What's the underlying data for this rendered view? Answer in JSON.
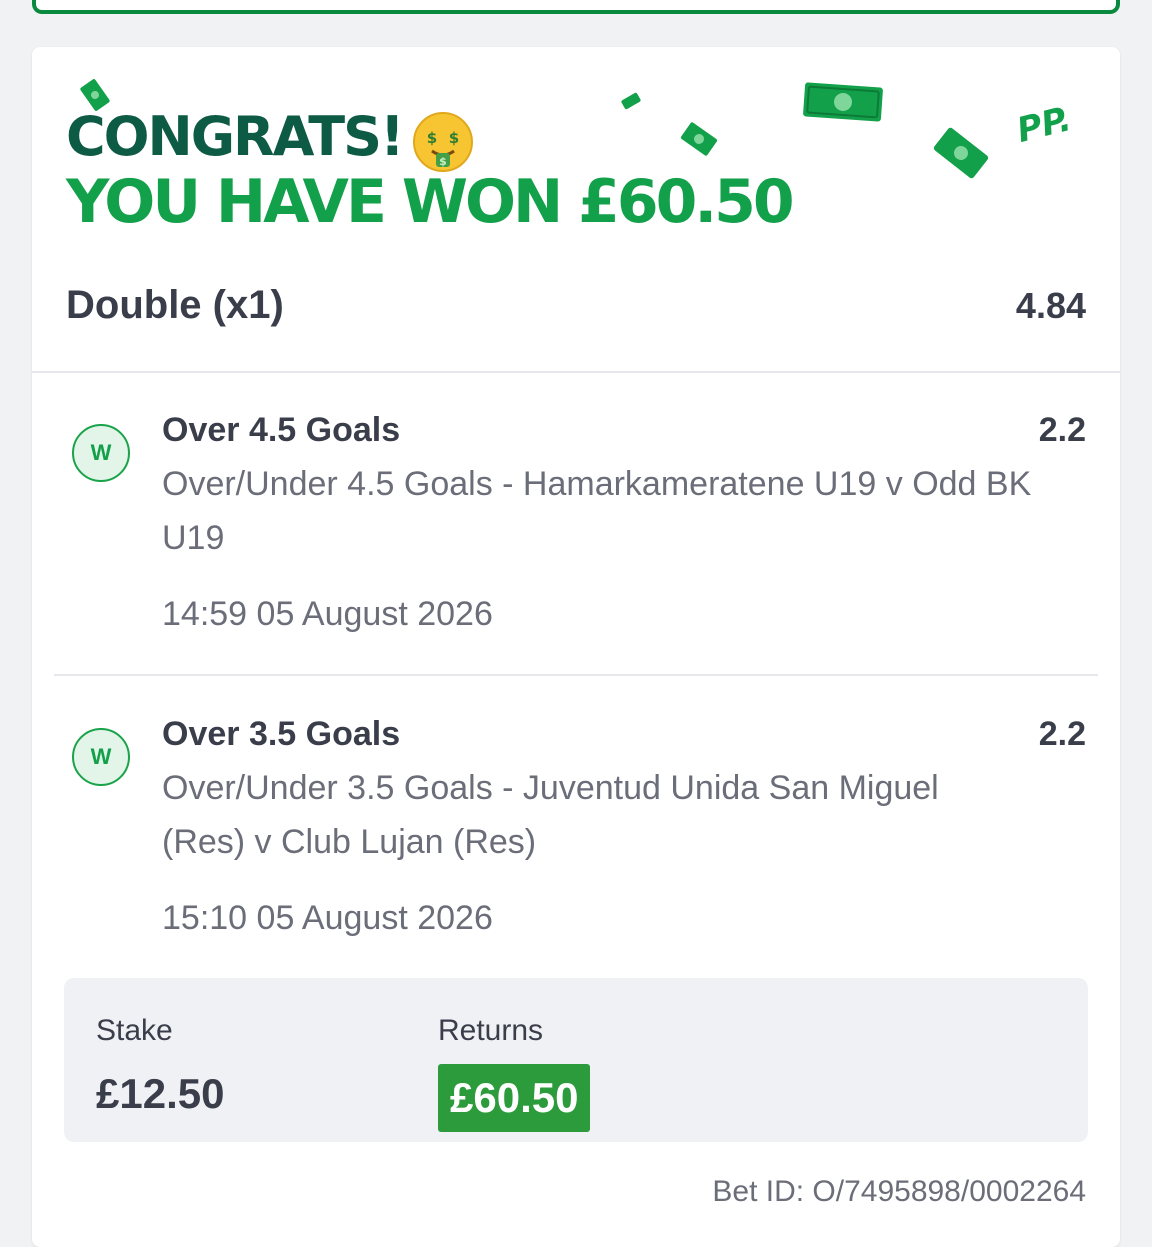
{
  "banner": {
    "congrats": "CONGRATS!",
    "won_text": "YOU HAVE WON £60.50",
    "brand_logo": "PP."
  },
  "bet": {
    "type": "Double (x1)",
    "odds": "4.84"
  },
  "legs": [
    {
      "badge": "W",
      "title": "Over 4.5 Goals",
      "odds": "2.2",
      "description": "Over/Under 4.5 Goals - Hamarkameratene U19 v Odd BK U19",
      "time": "14:59 05 August 2026"
    },
    {
      "badge": "W",
      "title": "Over 3.5 Goals",
      "odds": "2.2",
      "description": "Over/Under 3.5 Goals - Juventud Unida San Miguel (Res) v Club Lujan (Res)",
      "time": "15:10 05 August 2026"
    }
  ],
  "summary": {
    "stake_label": "Stake",
    "stake_value": "£12.50",
    "returns_label": "Returns",
    "returns_value": "£60.50"
  },
  "footer": {
    "bet_id": "Bet ID: O/7495898/0002264"
  },
  "colors": {
    "brand_green": "#12a14a",
    "dark_green": "#0d5a45",
    "returns_bg": "#2b9b3b",
    "text_dark": "#3a3d4a",
    "text_muted": "#6b6e79"
  },
  "icons": {
    "emoji": "money-mouth-face-icon",
    "bills": "money-bill-icon",
    "result_badge": "win-badge-icon"
  }
}
